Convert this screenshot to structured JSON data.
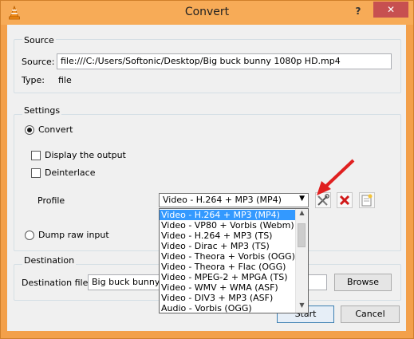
{
  "window": {
    "title": "Convert",
    "help": "?",
    "close": "✕",
    "app_icon": "vlc-cone-icon"
  },
  "source": {
    "group_label": "Source",
    "source_label": "Source:",
    "source_value": "file:///C:/Users/Softonic/Desktop/Big buck bunny 1080p HD.mp4",
    "type_label": "Type:",
    "type_value": "file"
  },
  "settings": {
    "group_label": "Settings",
    "convert_label": "Convert",
    "display_output_label": "Display the output",
    "deinterlace_label": "Deinterlace",
    "profile_label": "Profile",
    "profile_selected": "Video - H.264 + MP3 (MP4)",
    "dump_raw_label": "Dump raw input",
    "profile_options": [
      "Video - H.264 + MP3 (MP4)",
      "Video - VP80 + Vorbis (Webm)",
      "Video - H.264 + MP3 (TS)",
      "Video - Dirac + MP3 (TS)",
      "Video - Theora + Vorbis (OGG)",
      "Video - Theora + Flac (OGG)",
      "Video - MPEG-2 + MPGA (TS)",
      "Video - WMV + WMA (ASF)",
      "Video - DIV3 + MP3 (ASF)",
      "Audio - Vorbis (OGG)"
    ],
    "tool_icons": [
      "wrench-screwdriver-icon",
      "delete-x-icon",
      "new-profile-icon"
    ],
    "annotation": "red-arrow"
  },
  "destination": {
    "group_label": "Destination",
    "file_label": "Destination file:",
    "file_value": "Big buck bunny Yo",
    "browse_label": "Browse"
  },
  "buttons": {
    "start_label": "Start",
    "cancel_label": "Cancel"
  },
  "colors": {
    "title_bar": "#f7ab57",
    "close_button": "#c75050",
    "selection": "#3399ff",
    "annotation_arrow": "#e02020"
  }
}
